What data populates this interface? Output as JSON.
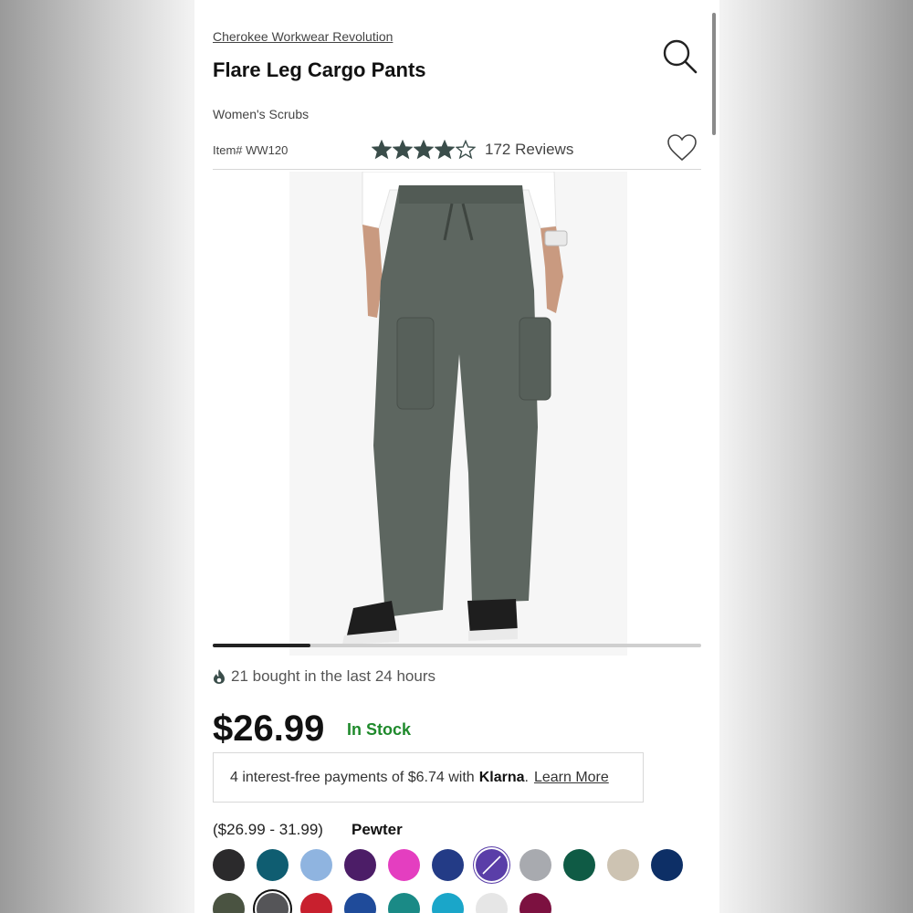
{
  "brand": "Cherokee Workwear Revolution",
  "title": "Flare Leg Cargo Pants",
  "category": "Women's Scrubs",
  "item_number": "Item# WW120",
  "rating": {
    "stars": 4,
    "out_of": 5,
    "reviews": "172 Reviews"
  },
  "gallery_progress": 0.2,
  "social_proof": "21 bought in the last 24 hours",
  "price": "$26.99",
  "stock": "In Stock",
  "klarna": {
    "text": "4 interest-free payments of $6.74 with",
    "brand": "Klarna",
    "period": ".",
    "link": "Learn More"
  },
  "price_range": "($26.99 - 31.99)",
  "selected_color": "Pewter",
  "swatches_row1": [
    "#2b2a2c",
    "#0f5d71",
    "#8fb4e0",
    "#4c1d67",
    "#e43ec0",
    "#233b86",
    "#5a3ea8",
    "#a8aaaf",
    "#0f5b45",
    "#cdc3b2",
    "#0d2f66"
  ],
  "swatches_row2": [
    "#4a5341",
    "#555558",
    "#c8202e",
    "#1f4b9a",
    "#1a8a86",
    "#1aa6c9",
    "#e6e6e6",
    "#7c1140"
  ],
  "icons": {
    "search": "search-icon",
    "heart": "heart-icon",
    "star": "star-icon",
    "flame": "flame-icon"
  },
  "colors": {
    "accent_stars": "#3a4d4a",
    "stock_green": "#1f8a2c"
  }
}
